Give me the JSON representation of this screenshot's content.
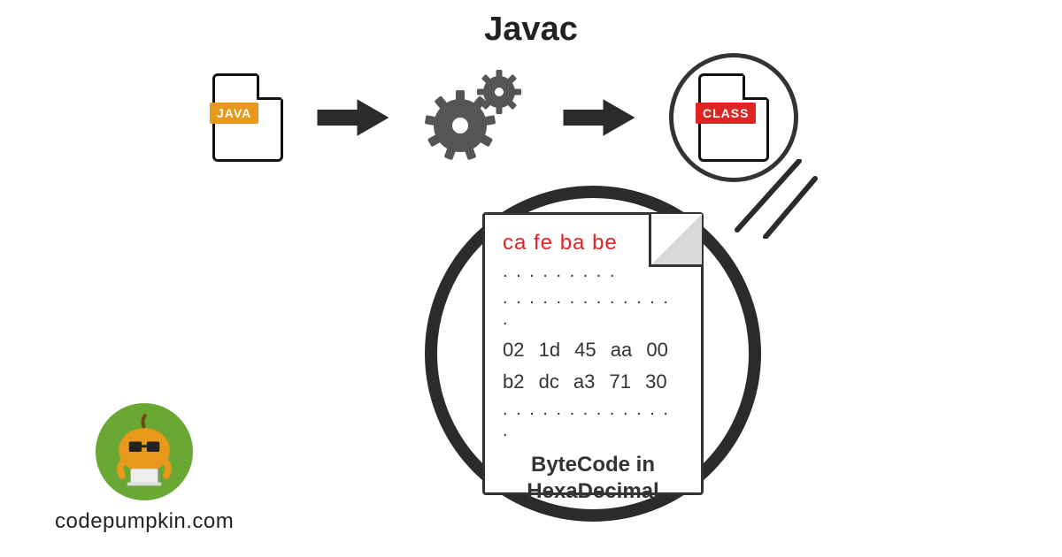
{
  "title": "Javac",
  "sourceFile": {
    "badge": "JAVA"
  },
  "outputFile": {
    "badge": "CLASS"
  },
  "bytecode": {
    "magic": "ca fe ba be",
    "dots1": ". .  . . .  . . . .",
    "dots2": ". .  . . .  . . . .  . . . . .",
    "rows": [
      "02  1d   45   aa   00",
      "b2  dc  a3   71   30"
    ],
    "dots3": ". .  . . .  . . . .  . . . . .",
    "captionLine1": "ByteCode in",
    "captionLine2": "HexaDecimal"
  },
  "branding": {
    "site": "codepumpkin.com"
  }
}
